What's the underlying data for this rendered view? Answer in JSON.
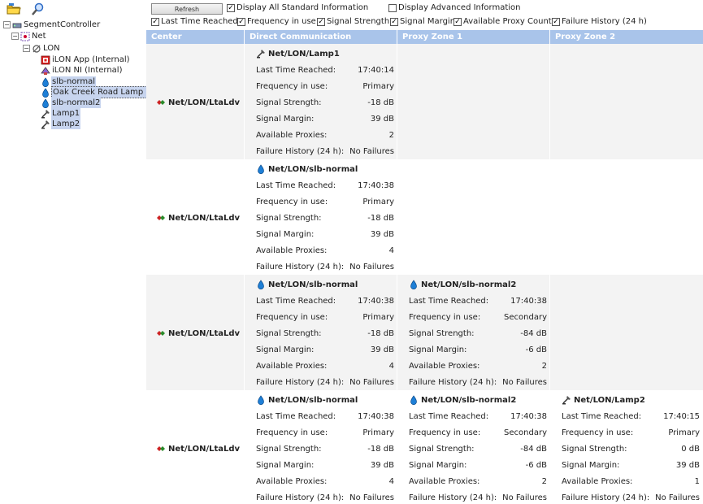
{
  "toolbar": {
    "icons": [
      "open-folder-icon",
      "search-icon"
    ]
  },
  "tree": {
    "nodes": [
      {
        "label": "SegmentController",
        "icon": "segment-controller-icon",
        "expander": "−"
      },
      {
        "label": "Net",
        "icon": "network-icon",
        "expander": "−"
      },
      {
        "label": "LON",
        "icon": "lon-channel-icon",
        "expander": "−"
      },
      {
        "label": "iLON App (Internal)",
        "icon": "ilon-app-icon"
      },
      {
        "label": "iLON NI (Internal)",
        "icon": "ilon-ni-icon"
      },
      {
        "label": "slb-normal",
        "icon": "drop-icon"
      },
      {
        "label": "Oak Creek Road Lamp (",
        "icon": "drop-icon"
      },
      {
        "label": "slb-normal2",
        "icon": "drop-icon"
      },
      {
        "label": "Lamp1",
        "icon": "lamp-icon"
      },
      {
        "label": "Lamp2",
        "icon": "lamp-icon"
      }
    ]
  },
  "controls": {
    "refresh_label": "Refresh",
    "display_all_standard": "Display All Standard Information",
    "display_advanced": "Display Advanced Information",
    "options": [
      {
        "label": "Last Time Reached",
        "checked": true
      },
      {
        "label": "Frequency in use",
        "checked": true
      },
      {
        "label": "Signal Strength",
        "checked": true
      },
      {
        "label": "Signal Margin",
        "checked": true
      },
      {
        "label": "Available Proxy Count",
        "checked": true
      },
      {
        "label": "Failure History (24 h)",
        "checked": true
      }
    ],
    "display_all_standard_checked": true,
    "display_advanced_checked": false
  },
  "grid": {
    "headers": [
      "Center",
      "Direct Communication",
      "Proxy Zone 1",
      "Proxy Zone 2"
    ],
    "field_labels": {
      "last_time": "Last Time Reached:",
      "frequency": "Frequency in use:",
      "strength": "Signal Strength:",
      "margin": "Signal Margin:",
      "proxies": "Available Proxies:",
      "failure": "Failure History (24 h):"
    },
    "rows": [
      {
        "center": "Net/LON/LtaLdv",
        "direct": {
          "name": "Net/LON/Lamp1",
          "icon": "lamp-icon",
          "last_time": "17:40:14",
          "frequency": "Primary",
          "strength": "-18 dB",
          "margin": "39 dB",
          "proxies": "2",
          "failure": "No Failures"
        }
      },
      {
        "center": "Net/LON/LtaLdv",
        "direct": {
          "name": "Net/LON/slb-normal",
          "icon": "drop-icon",
          "last_time": "17:40:38",
          "frequency": "Primary",
          "strength": "-18 dB",
          "margin": "39 dB",
          "proxies": "4",
          "failure": "No Failures"
        }
      },
      {
        "center": "Net/LON/LtaLdv",
        "direct": {
          "name": "Net/LON/slb-normal",
          "icon": "drop-icon",
          "last_time": "17:40:38",
          "frequency": "Primary",
          "strength": "-18 dB",
          "margin": "39 dB",
          "proxies": "4",
          "failure": "No Failures"
        },
        "proxy1": {
          "name": "Net/LON/slb-normal2",
          "icon": "drop-icon",
          "last_time": "17:40:38",
          "frequency": "Secondary",
          "strength": "-84 dB",
          "margin": "-6 dB",
          "proxies": "2",
          "failure": "No Failures"
        }
      },
      {
        "center": "Net/LON/LtaLdv",
        "direct": {
          "name": "Net/LON/slb-normal",
          "icon": "drop-icon",
          "last_time": "17:40:38",
          "frequency": "Primary",
          "strength": "-18 dB",
          "margin": "39 dB",
          "proxies": "4",
          "failure": "No Failures"
        },
        "proxy1": {
          "name": "Net/LON/slb-normal2",
          "icon": "drop-icon",
          "last_time": "17:40:38",
          "frequency": "Secondary",
          "strength": "-84 dB",
          "margin": "-6 dB",
          "proxies": "2",
          "failure": "No Failures"
        },
        "proxy2": {
          "name": "Net/LON/Lamp2",
          "icon": "lamp-icon",
          "last_time": "17:40:15",
          "frequency": "Primary",
          "strength": "0 dB",
          "margin": "39 dB",
          "proxies": "1",
          "failure": "No Failures"
        }
      }
    ]
  },
  "colors": {
    "header_bg": "#a9c4ea",
    "selection_bg": "#c7d4ee",
    "row_shade": "#f3f3f3"
  }
}
